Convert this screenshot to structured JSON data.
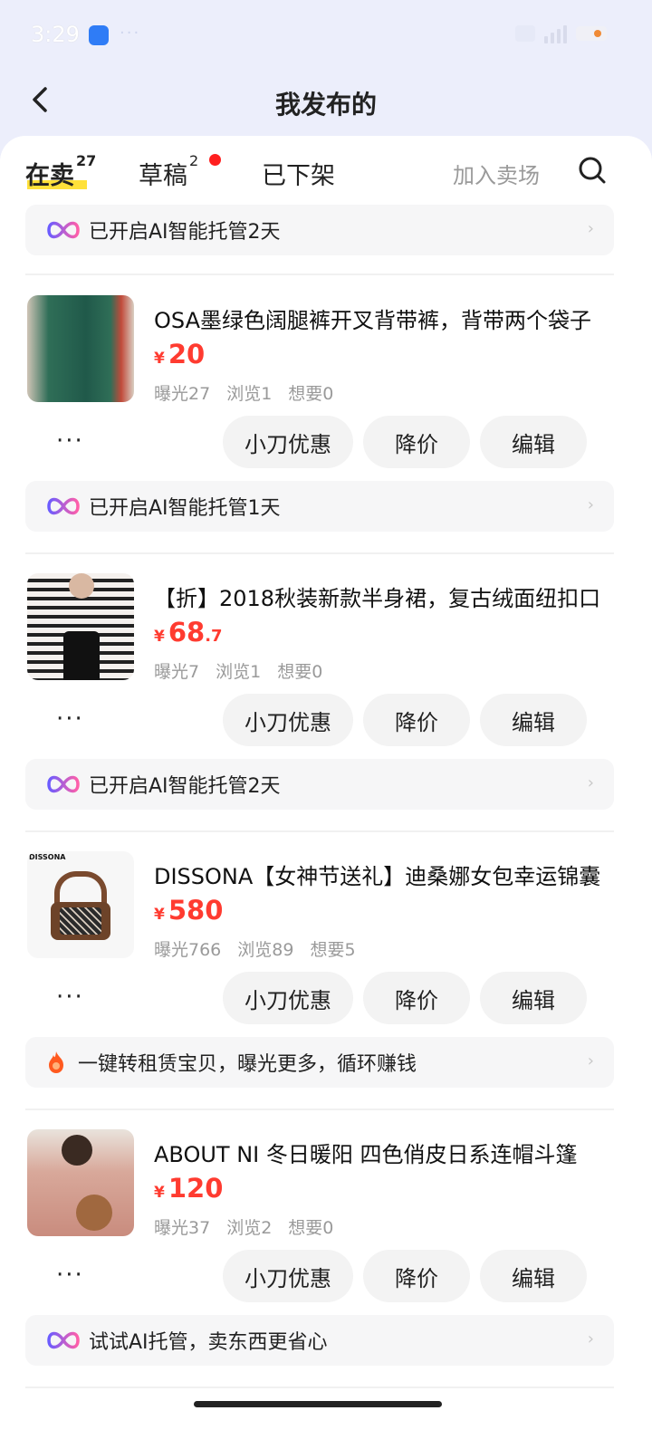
{
  "status": {
    "time": "3:29",
    "dots": "···"
  },
  "header": {
    "title": "我发布的"
  },
  "tabs": {
    "selling": {
      "label": "在卖",
      "count": "27"
    },
    "draft": {
      "label": "草稿",
      "count": "2"
    },
    "offshelf": {
      "label": "已下架"
    },
    "join_market": "加入卖场"
  },
  "top_notice": "已开启AI智能托管2天",
  "items": [
    {
      "title": "OSA墨绿色阔腿裤开叉背带裤，背带两个袋子",
      "currency": "¥",
      "price_int": "20",
      "price_dec": "",
      "stats": {
        "exposure": "曝光27",
        "views": "浏览1",
        "wants": "想要0"
      },
      "notice": "已开启AI智能托管1天",
      "notice_type": "ai"
    },
    {
      "title": "【折】2018秋装新款半身裙，复古绒面纽扣口",
      "currency": "¥",
      "price_int": "68",
      "price_dec": ".7",
      "stats": {
        "exposure": "曝光7",
        "views": "浏览1",
        "wants": "想要0"
      },
      "notice": "已开启AI智能托管2天",
      "notice_type": "ai"
    },
    {
      "title": "DISSONA【女神节送礼】迪桑娜女包幸运锦囊",
      "currency": "¥",
      "price_int": "580",
      "price_dec": "",
      "stats": {
        "exposure": "曝光766",
        "views": "浏览89",
        "wants": "想要5"
      },
      "thumb_text": "DISSONA",
      "notice": "一键转租赁宝贝，曝光更多，循环赚钱",
      "notice_type": "rent"
    },
    {
      "title": "ABOUT NI 冬日暖阳 四色俏皮日系连帽斗篷",
      "currency": "¥",
      "price_int": "120",
      "price_dec": "",
      "stats": {
        "exposure": "曝光37",
        "views": "浏览2",
        "wants": "想要0"
      },
      "notice": "试试AI托管，卖东西更省心",
      "notice_type": "ai"
    }
  ],
  "actions": {
    "more": "···",
    "haggle": "小刀优惠",
    "reduce": "降价",
    "edit": "编辑"
  },
  "colors": {
    "price": "#ff3b30",
    "highlight": "#ffe13a",
    "background": "#eceefb"
  }
}
